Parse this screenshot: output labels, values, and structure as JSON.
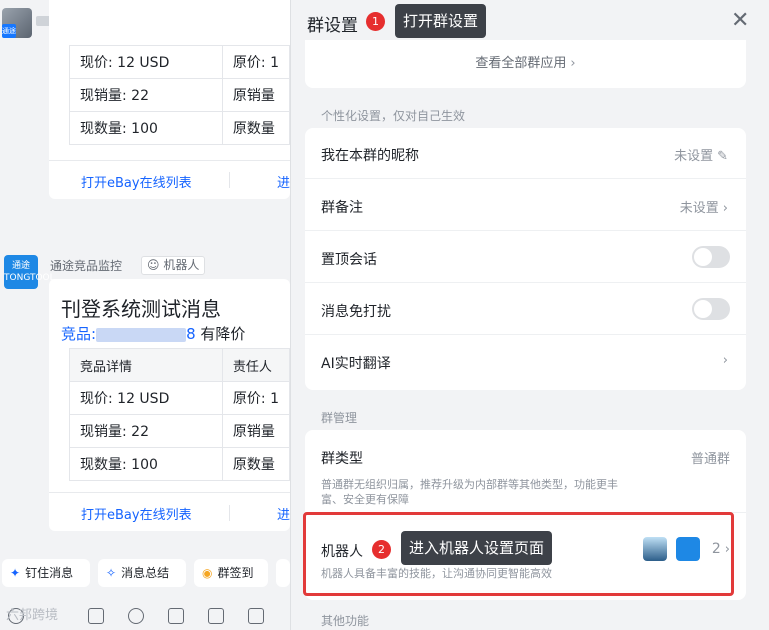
{
  "chat": {
    "top_badge": "通途",
    "card1": {
      "rows": [
        [
          "现价: 12 USD",
          "原价: 1"
        ],
        [
          "现销量: 22",
          "原销量"
        ],
        [
          "现数量: 100",
          "原数量"
        ]
      ],
      "link_open": "打开eBay在线列表",
      "link_more": "进"
    },
    "bot": {
      "avatar_text": "通途 TONGTOOL",
      "sender": "通途竞品监控",
      "tag": "机器人",
      "title": "刊登系统测试消息",
      "sub_prefix": "竞品:",
      "sub_tail": "8",
      "sub_suffix": " 有降价",
      "header_row": [
        "竞品详情",
        "责任人"
      ],
      "rows": [
        [
          "现价: 12 USD",
          "原价: 1"
        ],
        [
          "现销量: 22",
          "原销量"
        ],
        [
          "现数量: 100",
          "原数量"
        ]
      ],
      "link_open": "打开eBay在线列表",
      "link_more": "进"
    },
    "quick_actions": [
      {
        "icon": "pin-icon",
        "glyph": "✦",
        "label": "钉住消息"
      },
      {
        "icon": "sparkle-icon",
        "glyph": "✧",
        "label": "消息总结"
      },
      {
        "icon": "location-icon",
        "glyph": "◉",
        "label": "群签到"
      }
    ],
    "watermark": "六邦跨境"
  },
  "panel": {
    "title": "群设置",
    "callout1_num": "1",
    "callout1_text": "打开群设置",
    "close_glyph": "✕",
    "apps_link": "查看全部群应用",
    "personal_label": "个性化设置，仅对自己生效",
    "personal_rows": [
      {
        "label": "我在本群的昵称",
        "value": "未设置",
        "glyph": "✎"
      },
      {
        "label": "群备注",
        "value": "未设置",
        "glyph": "›"
      },
      {
        "label": "置顶会话",
        "toggle": false
      },
      {
        "label": "消息免打扰",
        "toggle": false
      },
      {
        "label": "AI实时翻译",
        "glyph": "›"
      }
    ],
    "manage_label": "群管理",
    "group_type": {
      "label": "群类型",
      "value": "普通群",
      "desc_line1": "普通群无组织归属，推荐升级为内部群等其他类型，功能更丰",
      "desc_line2": "富、安全更有保障"
    },
    "robot": {
      "label": "机器人",
      "callout2_num": "2",
      "callout2_text": "进入机器人设置页面",
      "desc": "机器人具备丰富的技能，让沟通协同更智能高效",
      "count": "2",
      "glyph": "›"
    },
    "other_label": "其他功能"
  },
  "colors": {
    "accent": "#1664ff",
    "highlight": "#e23a3a",
    "callout_bg": "#3d4148"
  }
}
